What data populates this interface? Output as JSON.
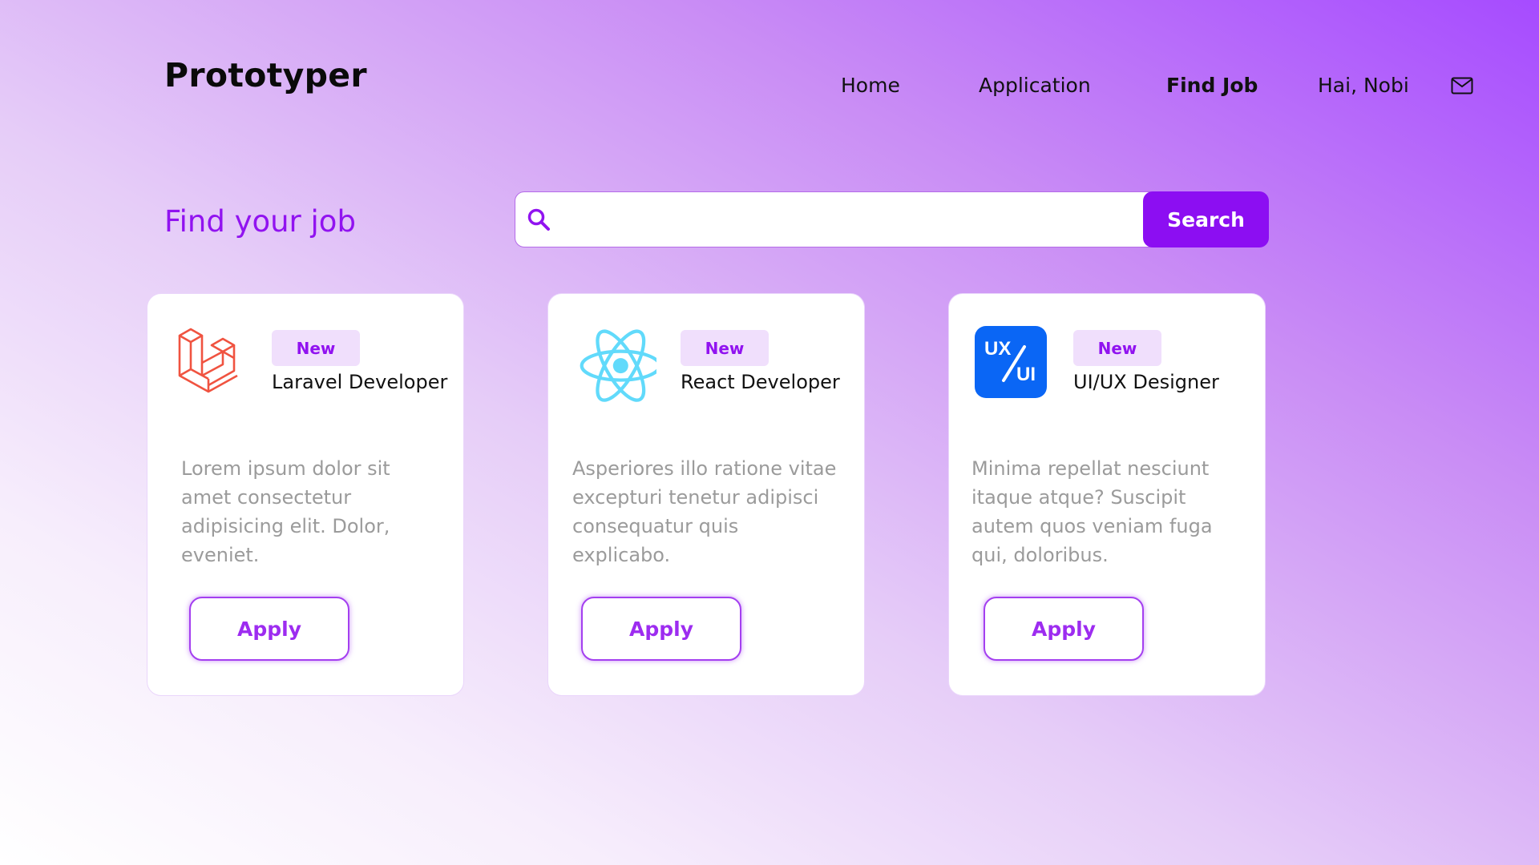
{
  "brand": "Prototyper",
  "nav": {
    "home": "Home",
    "application": "Application",
    "find_job": "Find Job",
    "greeting": "Hai, Nobi",
    "mail_icon": "mail-icon"
  },
  "search": {
    "title": "Find your job",
    "placeholder": "",
    "value": "",
    "button_label": "Search",
    "icon": "search-icon"
  },
  "colors": {
    "accent": "#8c0ef2",
    "title": "#9113f0",
    "laravel": "#f05340",
    "react": "#61dafb",
    "uxui": "#0a66f5"
  },
  "jobs": [
    {
      "badge": "New",
      "title": "Laravel Developer",
      "description": "Lorem ipsum dolor sit amet consectetur adipisicing elit. Dolor, eveniet.",
      "apply_label": "Apply",
      "logo": "laravel-logo"
    },
    {
      "badge": "New",
      "title": "React Developer",
      "description": "Asperiores illo ratione vitae excepturi tenetur adipisci consequatur quis explicabo.",
      "apply_label": "Apply",
      "logo": "react-logo"
    },
    {
      "badge": "New",
      "title": "UI/UX Designer",
      "description": "Minima repellat nesciunt itaque atque? Suscipit autem quos veniam fuga qui, doloribus.",
      "apply_label": "Apply",
      "logo": "uxui-logo",
      "logo_text_top": "UX",
      "logo_text_bottom": "UI"
    }
  ]
}
